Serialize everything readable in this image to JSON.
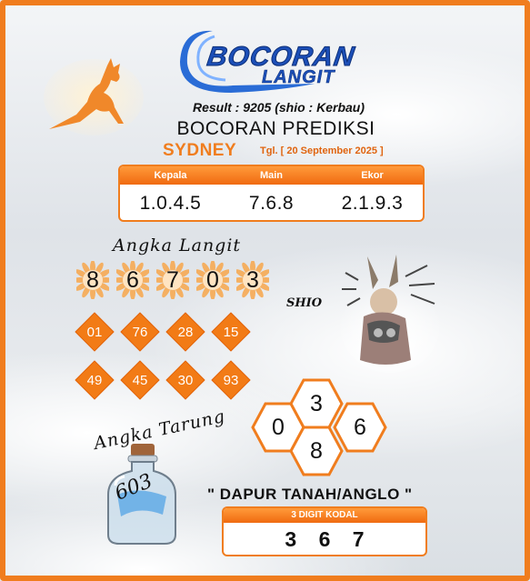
{
  "brand": {
    "line1": "BOCORAN",
    "line2": "LANGIT"
  },
  "result_line": "Result : 9205 (shio : Kerbau)",
  "headline": "BOCORAN PREDIKSI",
  "market": "SYDNEY",
  "date": "Tgl. [ 20 September 2025 ]",
  "prediction": {
    "columns": [
      "Kepala",
      "Main",
      "Ekor"
    ],
    "values": [
      "1.0.4.5",
      "7.6.8",
      "2.1.9.3"
    ]
  },
  "angka_langit": {
    "title": "Angka Langit",
    "digits": [
      "8",
      "6",
      "7",
      "0",
      "3"
    ],
    "pairs": [
      "01",
      "76",
      "28",
      "15",
      "49",
      "45",
      "30",
      "93"
    ]
  },
  "shio_label": "SHIO",
  "hex_digits": {
    "left": "0",
    "top": "3",
    "bottom": "8",
    "right": "6"
  },
  "angka_tarung": {
    "title": "Angka Tarung",
    "value": "603"
  },
  "shio_name": "\" DAPUR TANAH/ANGLO \"",
  "kodal": {
    "label": "3 DIGIT KODAL",
    "value": "3 6 7"
  },
  "colors": {
    "accent": "#f07d1e",
    "logo_blue": "#1c4fb8"
  },
  "icons": [
    "kangaroo-icon",
    "logo-swoosh-icon",
    "bottle-icon",
    "rabbit-illustration"
  ]
}
